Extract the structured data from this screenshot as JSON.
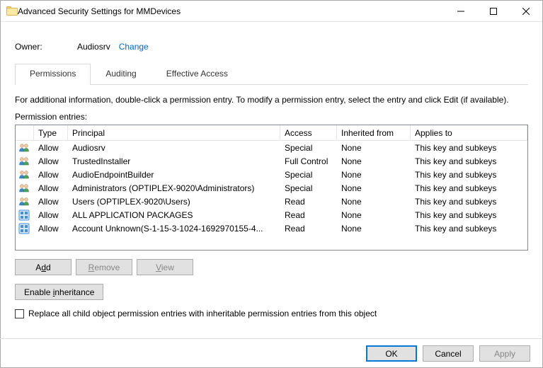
{
  "window": {
    "title": "Advanced Security Settings for MMDevices",
    "min_label": "Minimize",
    "max_label": "Maximize",
    "close_label": "Close"
  },
  "owner": {
    "label": "Owner:",
    "name": "Audiosrv",
    "change": "Change"
  },
  "tabs": {
    "permissions": "Permissions",
    "auditing": "Auditing",
    "effective": "Effective Access"
  },
  "instructions": "For additional information, double-click a permission entry. To modify a permission entry, select the entry and click Edit (if available).",
  "entries_label": "Permission entries:",
  "columns": {
    "type": "Type",
    "principal": "Principal",
    "access": "Access",
    "inherited": "Inherited from",
    "applies": "Applies to"
  },
  "rows": [
    {
      "icon": "users",
      "type": "Allow",
      "principal": "Audiosrv",
      "access": "Special",
      "inherited": "None",
      "applies": "This key and subkeys"
    },
    {
      "icon": "users",
      "type": "Allow",
      "principal": "TrustedInstaller",
      "access": "Full Control",
      "inherited": "None",
      "applies": "This key and subkeys"
    },
    {
      "icon": "users",
      "type": "Allow",
      "principal": "AudioEndpointBuilder",
      "access": "Special",
      "inherited": "None",
      "applies": "This key and subkeys"
    },
    {
      "icon": "users",
      "type": "Allow",
      "principal": "Administrators (OPTIPLEX-9020\\Administrators)",
      "access": "Special",
      "inherited": "None",
      "applies": "This key and subkeys"
    },
    {
      "icon": "users",
      "type": "Allow",
      "principal": "Users (OPTIPLEX-9020\\Users)",
      "access": "Read",
      "inherited": "None",
      "applies": "This key and subkeys"
    },
    {
      "icon": "app",
      "type": "Allow",
      "principal": "ALL APPLICATION PACKAGES",
      "access": "Read",
      "inherited": "None",
      "applies": "This key and subkeys"
    },
    {
      "icon": "app",
      "type": "Allow",
      "principal": "Account Unknown(S-1-15-3-1024-1692970155-4...",
      "access": "Read",
      "inherited": "None",
      "applies": "This key and subkeys"
    }
  ],
  "buttons": {
    "add": "Add",
    "remove": "Remove",
    "view": "View",
    "enable_inheritance": "Enable inheritance",
    "replace_children": "Replace all child object permission entries with inheritable permission entries from this object",
    "ok": "OK",
    "cancel": "Cancel",
    "apply": "Apply"
  }
}
